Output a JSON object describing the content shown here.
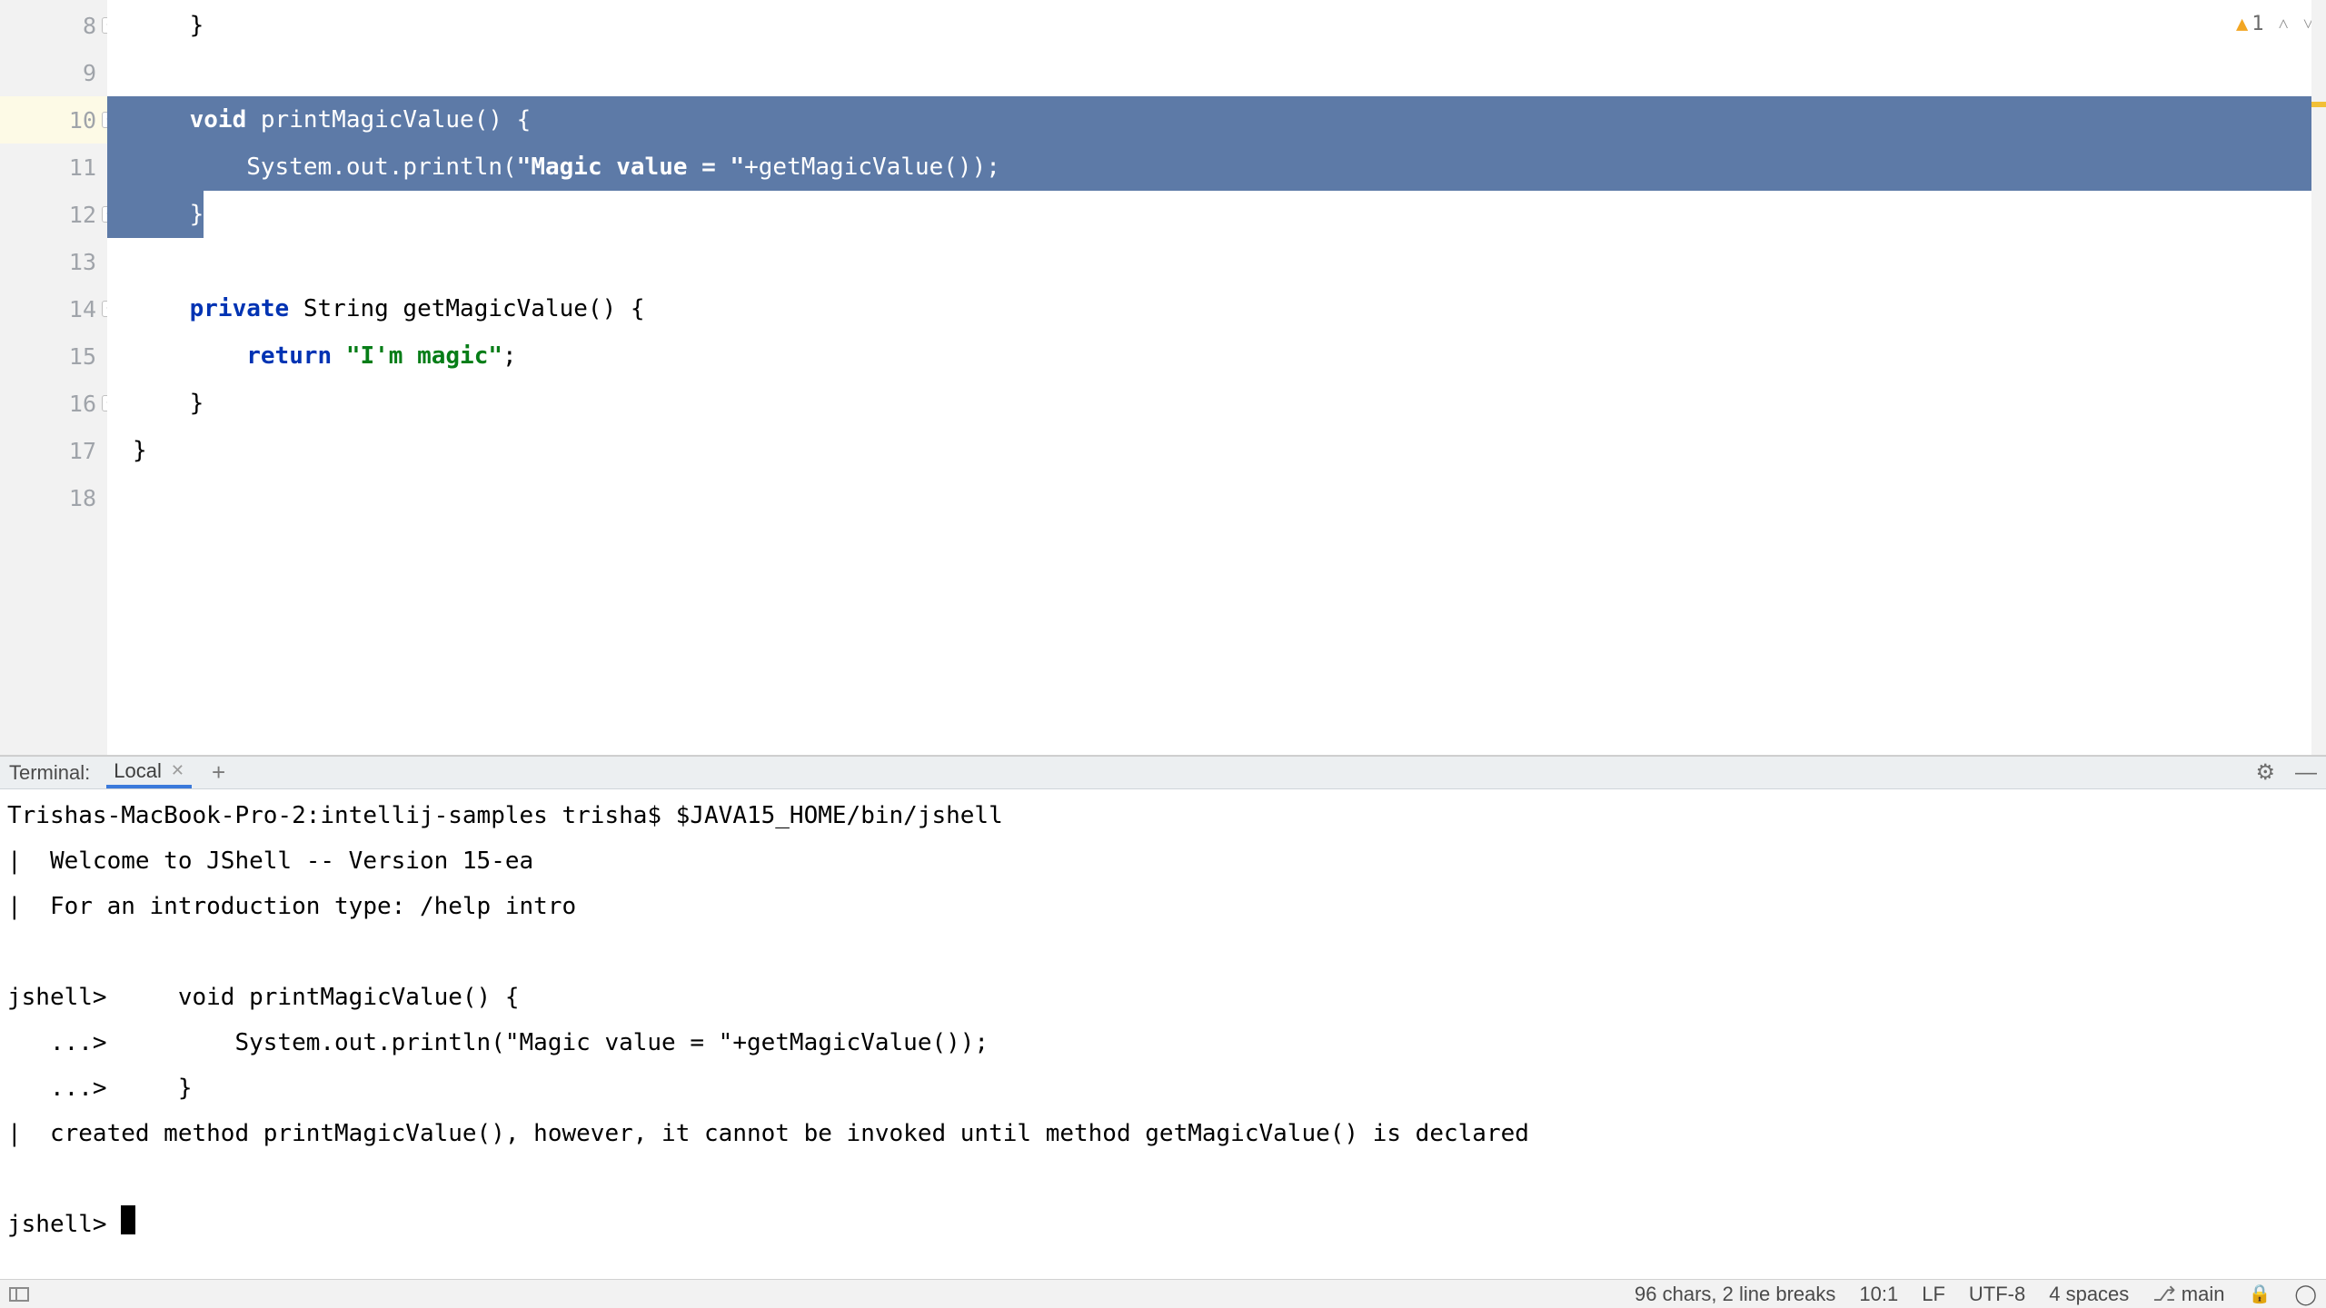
{
  "editor": {
    "line_numbers": [
      "8",
      "9",
      "10",
      "11",
      "12",
      "13",
      "14",
      "15",
      "16",
      "17",
      "18"
    ],
    "warning_count": "1",
    "code": {
      "l8": "    }",
      "l9": "",
      "l10_kw": "void",
      "l10_rest": " printMagicValue() {",
      "l11_a": "        System.",
      "l11_field": "out",
      "l11_b": ".println(",
      "l11_str": "\"Magic value = \"",
      "l11_c": "+getMagicValue());",
      "l12": "    }",
      "l13": "",
      "l14_kw": "private",
      "l14_rest": " String getMagicValue() {",
      "l15_kw": "return",
      "l15_sp": "        ",
      "l15_sp2": " ",
      "l15_str": "\"I'm magic\"",
      "l15_semi": ";",
      "l16": "    }",
      "l17": "}",
      "l18": ""
    }
  },
  "terminal": {
    "label": "Terminal:",
    "tab_name": "Local",
    "lines": {
      "l1": "Trishas-MacBook-Pro-2:intellij-samples trisha$ $JAVA15_HOME/bin/jshell",
      "l2": "|  Welcome to JShell -- Version 15-ea",
      "l3": "|  For an introduction type: /help intro",
      "l4": "",
      "l5": "jshell>     void printMagicValue() {",
      "l6": "   ...>         System.out.println(\"Magic value = \"+getMagicValue());",
      "l7": "   ...>     }",
      "l8": "|  created method printMagicValue(), however, it cannot be invoked until method getMagicValue() is declared",
      "l9": "",
      "l10": "jshell> "
    }
  },
  "status": {
    "selection": "96 chars, 2 line breaks",
    "caret": "10:1",
    "line_sep": "LF",
    "encoding": "UTF-8",
    "indent": "4 spaces",
    "branch": "main"
  }
}
